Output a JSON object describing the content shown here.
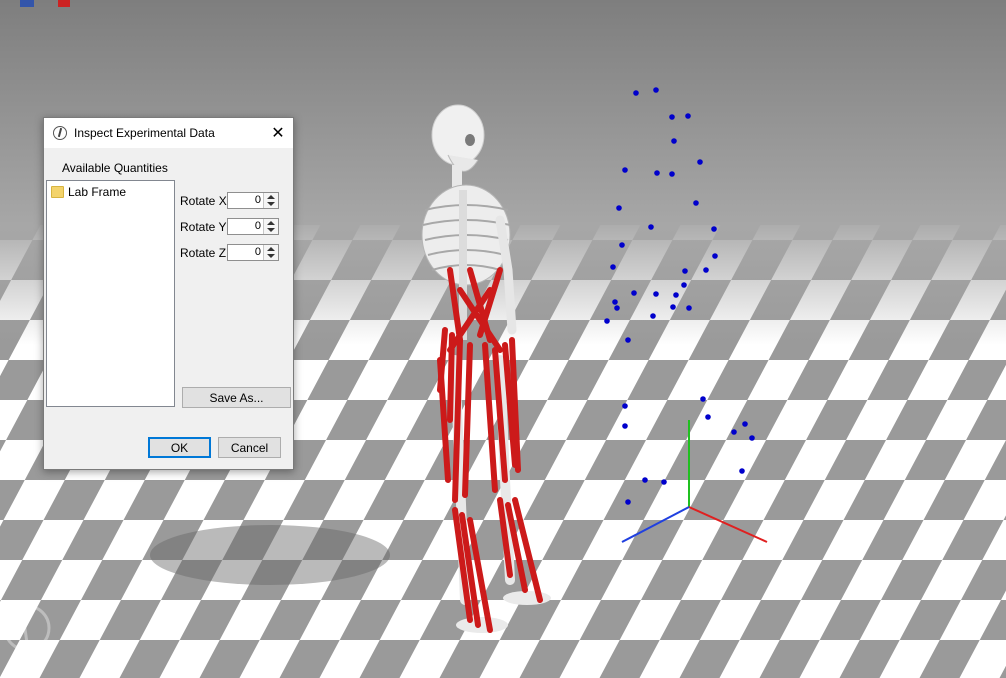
{
  "dialog": {
    "title": "Inspect Experimental Data",
    "available_quantities_label": "Available Quantities",
    "tree_items": [
      {
        "label": "Lab Frame",
        "icon": "folder-icon"
      }
    ],
    "rotate": [
      {
        "label": "Rotate X",
        "value": "0"
      },
      {
        "label": "Rotate Y",
        "value": "0"
      },
      {
        "label": "Rotate Z",
        "value": "0"
      }
    ],
    "save_as_label": "Save As...",
    "ok_label": "OK",
    "cancel_label": "Cancel",
    "close_icon": "close-icon"
  },
  "scene": {
    "marker_color": "#0000cc",
    "muscle_color": "#cc1a1a",
    "bone_color": "#f0f0f0",
    "axis_colors": {
      "x": "#e02020",
      "y": "#20c020",
      "z": "#2040e0"
    },
    "background_color": "#8a8a8a"
  }
}
